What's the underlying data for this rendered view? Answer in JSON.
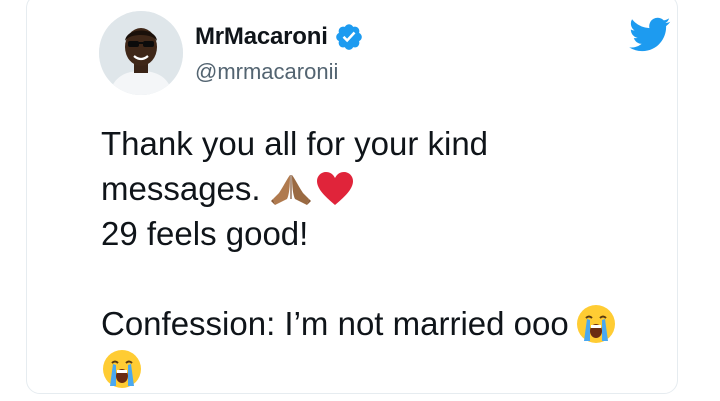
{
  "tweet": {
    "author": {
      "display_name": "MrMacaroni",
      "handle": "@mrmacaronii",
      "verified": true,
      "avatar_icon": "profile-photo"
    },
    "platform_icon": "twitter-bird-icon",
    "lines": [
      "Thank you all for your kind",
      "messages.",
      "29 feels good!",
      "",
      "Confession: I’m not married ooo"
    ],
    "emojis": {
      "line2": [
        "folded-hands-icon",
        "red-heart-icon"
      ],
      "line5": [
        "loudly-crying-face-icon"
      ],
      "line6": [
        "loudly-crying-face-icon"
      ]
    }
  },
  "colors": {
    "twitter_blue": "#1d9bf0",
    "text_primary": "#0f1419",
    "text_secondary": "#536471",
    "heart_red": "#e0243a"
  }
}
